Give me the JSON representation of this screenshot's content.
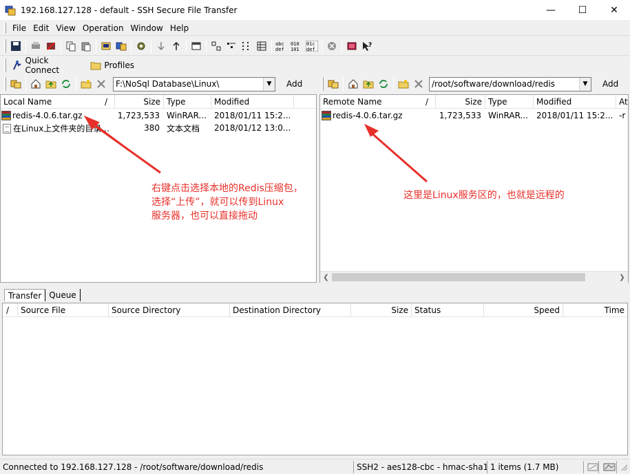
{
  "window": {
    "title": "192.168.127.128 - default - SSH Secure File Transfer",
    "minimize": "—",
    "maximize": "☐",
    "close": "✕"
  },
  "menu": [
    "File",
    "Edit",
    "View",
    "Operation",
    "Window",
    "Help"
  ],
  "quickbar": {
    "quick_connect": "Quick Connect",
    "profiles": "Profiles"
  },
  "local": {
    "path": "F:\\NoSql Database\\Linux\\",
    "add": "Add",
    "columns": [
      "Local Name",
      "/",
      "Size",
      "Type",
      "Modified"
    ],
    "files": [
      {
        "name": "redis-4.0.6.tar.gz",
        "size": "1,723,533",
        "type": "WinRAR...",
        "modified": "2018/01/11 15:2..."
      },
      {
        "name": "在Linux上文件夹的目录...",
        "size": "380",
        "type": "文本文档",
        "modified": "2018/01/12 13:0..."
      }
    ]
  },
  "remote": {
    "path": "/root/software/download/redis",
    "add": "Add",
    "columns": [
      "Remote Name",
      "/",
      "Size",
      "Type",
      "Modified",
      "At..."
    ],
    "files": [
      {
        "name": "redis-4.0.6.tar.gz",
        "size": "1,723,533",
        "type": "WinRAR...",
        "modified": "2018/01/11 15:2...",
        "attr": "-r"
      }
    ]
  },
  "annotations": {
    "left": [
      "右键点击选择本地的Redis压缩包，",
      "选择“上传”，就可以传到Linux",
      "服务器，也可以直接拖动"
    ],
    "right": "这里是Linux服务区的，也就是远程的"
  },
  "tabs": [
    "Transfer",
    "Queue"
  ],
  "transfer_columns": [
    "/",
    "Source File",
    "Source Directory",
    "Destination Directory",
    "Size",
    "Status",
    "Speed",
    "Time"
  ],
  "status": {
    "connection": "Connected to 192.168.127.128 - /root/software/download/redis",
    "cipher": "SSH2 - aes128-cbc - hmac-sha1",
    "items": "1 items (1.7 MB)"
  },
  "colors": {
    "annotation": "#e8302a"
  }
}
